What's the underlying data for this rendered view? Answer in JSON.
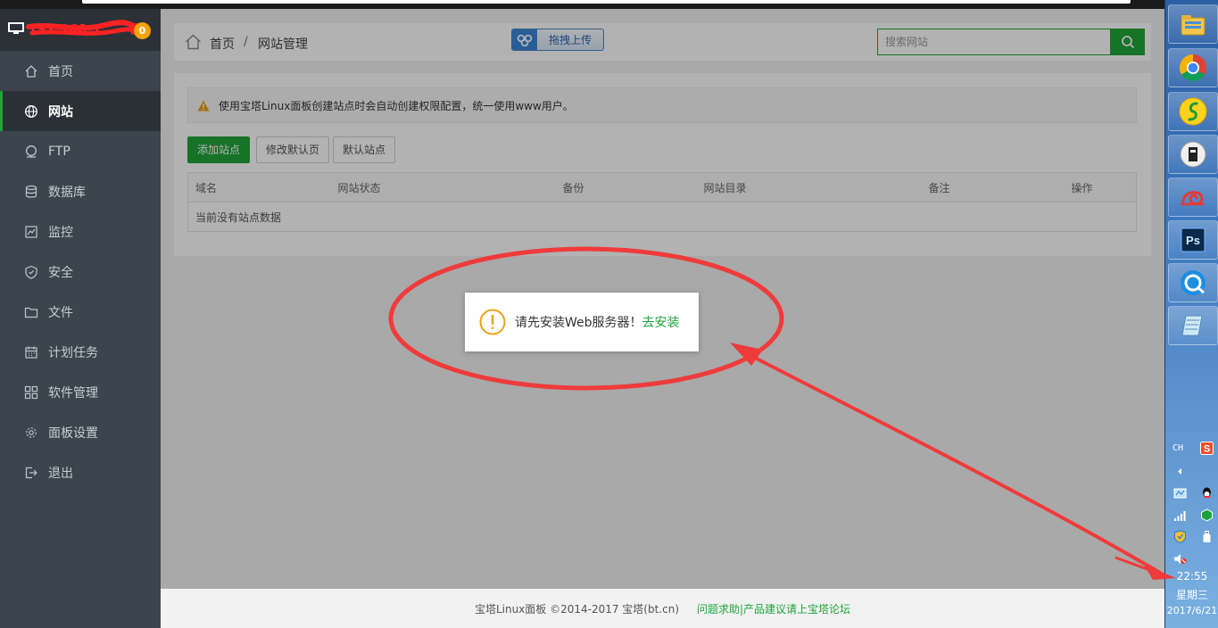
{
  "sidebar": {
    "ip_text": "192.168.1",
    "badge": "0",
    "items": [
      {
        "label": "首页",
        "icon": "home-icon"
      },
      {
        "label": "网站",
        "icon": "globe-icon",
        "active": true
      },
      {
        "label": "FTP",
        "icon": "ftp-icon"
      },
      {
        "label": "数据库",
        "icon": "database-icon"
      },
      {
        "label": "监控",
        "icon": "monitor-icon"
      },
      {
        "label": "安全",
        "icon": "shield-icon"
      },
      {
        "label": "文件",
        "icon": "folder-icon"
      },
      {
        "label": "计划任务",
        "icon": "calendar-icon"
      },
      {
        "label": "软件管理",
        "icon": "grid-icon"
      },
      {
        "label": "面板设置",
        "icon": "gear-icon"
      },
      {
        "label": "退出",
        "icon": "logout-icon"
      }
    ]
  },
  "breadcrumb": {
    "home": "首页",
    "separator": "/",
    "current": "网站管理"
  },
  "upload": {
    "label": "拖拽上传"
  },
  "search": {
    "placeholder": "搜索网站"
  },
  "alert": {
    "text": "使用宝塔Linux面板创建站点时会自动创建权限配置，统一使用www用户。"
  },
  "buttons": {
    "add": "添加站点",
    "modify_default": "修改默认页",
    "default_site": "默认站点"
  },
  "table": {
    "columns": [
      "域名",
      "网站状态",
      "备份",
      "网站目录",
      "备注",
      "操作"
    ],
    "empty": "当前没有站点数据"
  },
  "toast": {
    "message": "请先安装Web服务器！",
    "link": "去安装"
  },
  "footer": {
    "copyright": "宝塔Linux面板 ©2014-2017 宝塔(bt.cn)",
    "link": "问题求助|产品建议请上宝塔论坛"
  },
  "taskbar": {
    "apps": [
      "file-explorer-icon",
      "chrome-icon",
      "music-player-icon",
      "user-app-icon",
      "snail-app-icon",
      "photoshop-icon",
      "browser-icon",
      "notepad-icon"
    ],
    "photoshop_label": "Ps",
    "input_lang": "CH",
    "ime_label": "S",
    "time": "22:55",
    "day": "星期三",
    "date": "2017/6/21"
  },
  "colors": {
    "accent": "#20a53a",
    "sidebar": "#3c444d",
    "annotation": "#ef3b3b"
  }
}
